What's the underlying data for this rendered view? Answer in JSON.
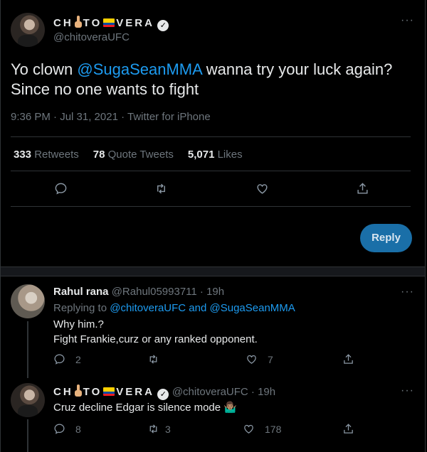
{
  "main_tweet": {
    "display_name": "CH TO VERA",
    "handle": "@chitoveraUFC",
    "text_prefix": "Yo clown ",
    "mention": "@SugaSeanMMA",
    "text_line1_suffix": " wanna try your luck again?",
    "text_line2": "Since no one wants to fight",
    "timestamp": "9:36 PM · Jul 31, 2021 · ",
    "source": "Twitter for iPhone",
    "stats": {
      "retweets_count": "333",
      "retweets_label": "Retweets",
      "quotes_count": "78",
      "quotes_label": "Quote Tweets",
      "likes_count": "5,071",
      "likes_label": "Likes"
    },
    "reply_button": "Reply"
  },
  "replies": [
    {
      "display_name": "Rahul rana",
      "handle_time": "@Rahul05993711 · 19h",
      "replying_to_label": "Replying to ",
      "replying_to_users": "@chitoveraUFC and @SugaSeanMMA",
      "text_line1": "Why him.?",
      "text_line2": "Fight Frankie,curz or any ranked opponent.",
      "reply_count": "2",
      "retweet_count": "",
      "like_count": "7"
    },
    {
      "display_name": "CH TO VERA",
      "handle_time": "@chitoveraUFC · 19h",
      "text_line1": "Cruz decline Edgar is silence mode 🤷🏽‍♂️",
      "reply_count": "8",
      "retweet_count": "3",
      "like_count": "178"
    }
  ],
  "icons": [
    "more-icon",
    "verified-badge",
    "reply-icon",
    "retweet-icon",
    "like-icon",
    "share-icon"
  ]
}
